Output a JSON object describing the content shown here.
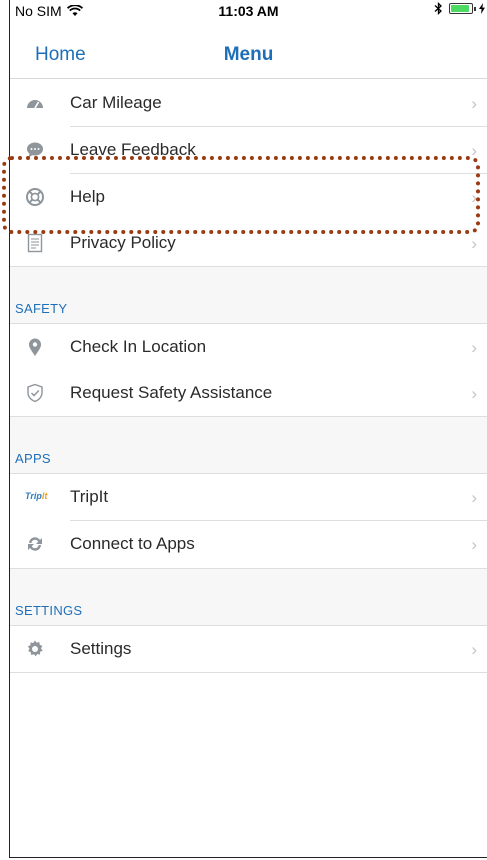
{
  "statusbar": {
    "carrier": "No SIM",
    "time": "11:03 AM"
  },
  "nav": {
    "back_label": "Home",
    "title": "Menu"
  },
  "items": [
    {
      "label": "Car Mileage",
      "icon": "speedometer-icon"
    },
    {
      "label": "Leave Feedback",
      "icon": "chat-bubble-icon"
    },
    {
      "label": "Help",
      "icon": "lifebuoy-icon"
    },
    {
      "label": "Privacy Policy",
      "icon": "document-icon"
    }
  ],
  "sections": [
    {
      "title": "SAFETY",
      "items": [
        {
          "label": "Check In Location",
          "icon": "location-pin-icon"
        },
        {
          "label": "Request Safety Assistance",
          "icon": "shield-check-icon"
        }
      ]
    },
    {
      "title": "APPS",
      "items": [
        {
          "label": "TripIt",
          "icon": "tripit-logo"
        },
        {
          "label": "Connect to Apps",
          "icon": "sync-icon"
        }
      ]
    },
    {
      "title": "SETTINGS",
      "items": [
        {
          "label": "Settings",
          "icon": "gear-icon"
        }
      ]
    }
  ],
  "chevron": "›",
  "colors": {
    "accent": "#1f6fb8",
    "highlight_border": "#9a3a10",
    "section_bg": "#f7f7f7",
    "battery": "#4cd964"
  }
}
